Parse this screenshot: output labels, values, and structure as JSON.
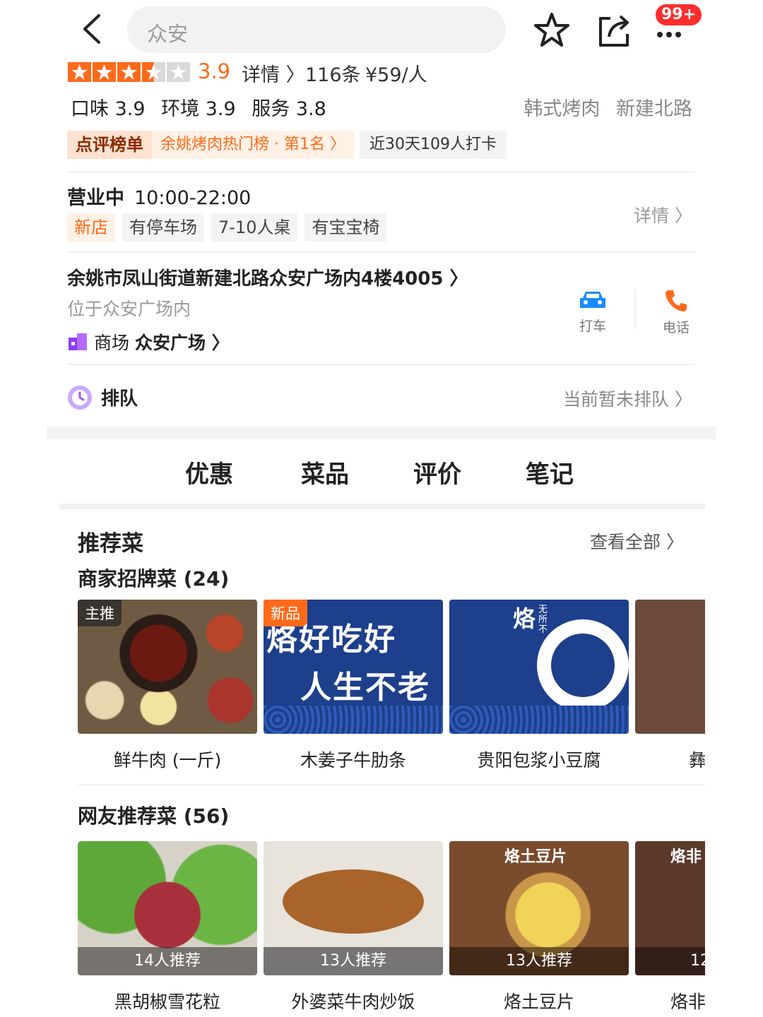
{
  "header": {
    "search_text": "众安",
    "badge": "99+"
  },
  "rating": {
    "stars": 3.5,
    "score": "3.9",
    "detail": "详情 〉",
    "reviews": "116条",
    "price": "¥59/人"
  },
  "subscores": [
    "口味 3.9",
    "环境 3.9",
    "服务 3.8"
  ],
  "categories": [
    "韩式烤肉",
    "新建北路"
  ],
  "ranking": {
    "title": "点评榜单",
    "text": "余姚烤肉热门榜 · 第1名 〉",
    "checkin": "近30天109人打卡"
  },
  "hours": {
    "status": "营业中",
    "time": "10:00-22:00",
    "detail": "详情 〉",
    "tags": [
      "新店",
      "有停车场",
      "7-10人桌",
      "有宝宝椅"
    ]
  },
  "address": {
    "line": "余姚市凤山街道新建北路众安广场内4楼4005 〉",
    "sub": "位于众安广场内",
    "mall_prefix": "商场",
    "mall_name": "众安广场 〉",
    "taxi": "打车",
    "phone": "电话"
  },
  "queue": {
    "label": "排队",
    "status": "当前暂未排队 〉"
  },
  "tabs": [
    "优惠",
    "菜品",
    "评价",
    "笔记"
  ],
  "recommend": {
    "title": "推荐菜",
    "see_all": "查看全部 〉",
    "signature_title": "商家招牌菜 (24)",
    "signature": [
      {
        "name": "鲜牛肉 (一斤)",
        "label": "主推"
      },
      {
        "name": "木姜子牛肋条",
        "label": "新品",
        "img_text1": "烙好吃好",
        "img_text2": "人生不老"
      },
      {
        "name": "贵阳包浆小豆腐",
        "img_text1": "烙",
        "img_text2": "无所不"
      },
      {
        "name": "彝"
      }
    ],
    "netizen_title": "网友推荐菜 (56)",
    "netizen": [
      {
        "name": "黑胡椒雪花粒",
        "count": "14人推荐"
      },
      {
        "name": "外婆菜牛肉炒饭",
        "count": "13人推荐"
      },
      {
        "name": "烙土豆片",
        "count": "13人推荐",
        "img_text": "烙土豆片"
      },
      {
        "name": "烙非",
        "count": "12",
        "img_text": "烙非"
      }
    ]
  },
  "colors": {
    "accent": "#ff6a1a",
    "badge": "#ff2d2d",
    "tab_underline": "#ff3a3a",
    "blue_card": "#1d3f8c"
  }
}
